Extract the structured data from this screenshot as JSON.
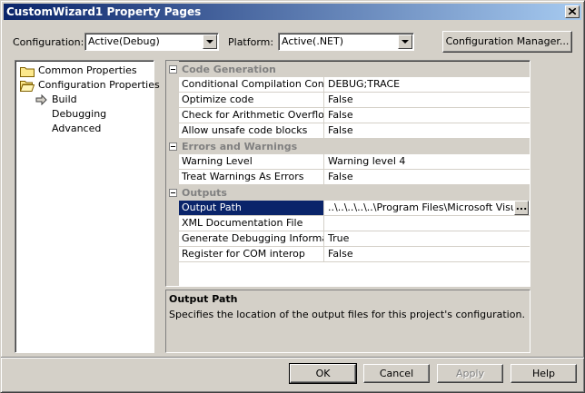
{
  "window": {
    "title": "CustomWizard1 Property Pages",
    "close_glyph": "close-icon"
  },
  "toolbar": {
    "configuration_label": "Configuration:",
    "configuration_value": "Active(Debug)",
    "platform_label": "Platform:",
    "platform_value": "Active(.NET)",
    "config_manager_label": "Configuration Manager..."
  },
  "tree": {
    "items": [
      {
        "label": "Common Properties",
        "icon": "folder-closed-icon"
      },
      {
        "label": "Configuration Properties",
        "icon": "folder-open-icon"
      },
      {
        "label": "Build",
        "icon": "arrow-right-icon",
        "selected": true
      },
      {
        "label": "Debugging"
      },
      {
        "label": "Advanced"
      }
    ]
  },
  "grid": {
    "categories": [
      {
        "name": "Code Generation",
        "rows": [
          {
            "name": "Conditional Compilation Constant",
            "value": "DEBUG;TRACE"
          },
          {
            "name": "Optimize code",
            "value": "False"
          },
          {
            "name": "Check for Arithmetic Overflow/Un",
            "value": "False"
          },
          {
            "name": "Allow unsafe code blocks",
            "value": "False"
          }
        ]
      },
      {
        "name": "Errors and Warnings",
        "rows": [
          {
            "name": "Warning Level",
            "value": "Warning level 4"
          },
          {
            "name": "Treat Warnings As Errors",
            "value": "False"
          }
        ]
      },
      {
        "name": "Outputs",
        "rows": [
          {
            "name": "Output Path",
            "value": "..\\..\\..\\..\\..\\Program Files\\Microsoft Visual",
            "selected": true
          },
          {
            "name": "XML Documentation File",
            "value": ""
          },
          {
            "name": "Generate Debugging Information",
            "value": "True"
          },
          {
            "name": "Register for COM interop",
            "value": "False"
          }
        ]
      }
    ],
    "ellipsis_label": "..."
  },
  "description": {
    "title": "Output Path",
    "text": "Specifies the location of the output files for this project's configuration."
  },
  "buttons": {
    "ok": "OK",
    "cancel": "Cancel",
    "apply": "Apply",
    "help": "Help"
  },
  "colors": {
    "face": "#d4d0c8",
    "title_start": "#0a246a",
    "title_end": "#a6caf0",
    "selection": "#0a246a"
  }
}
